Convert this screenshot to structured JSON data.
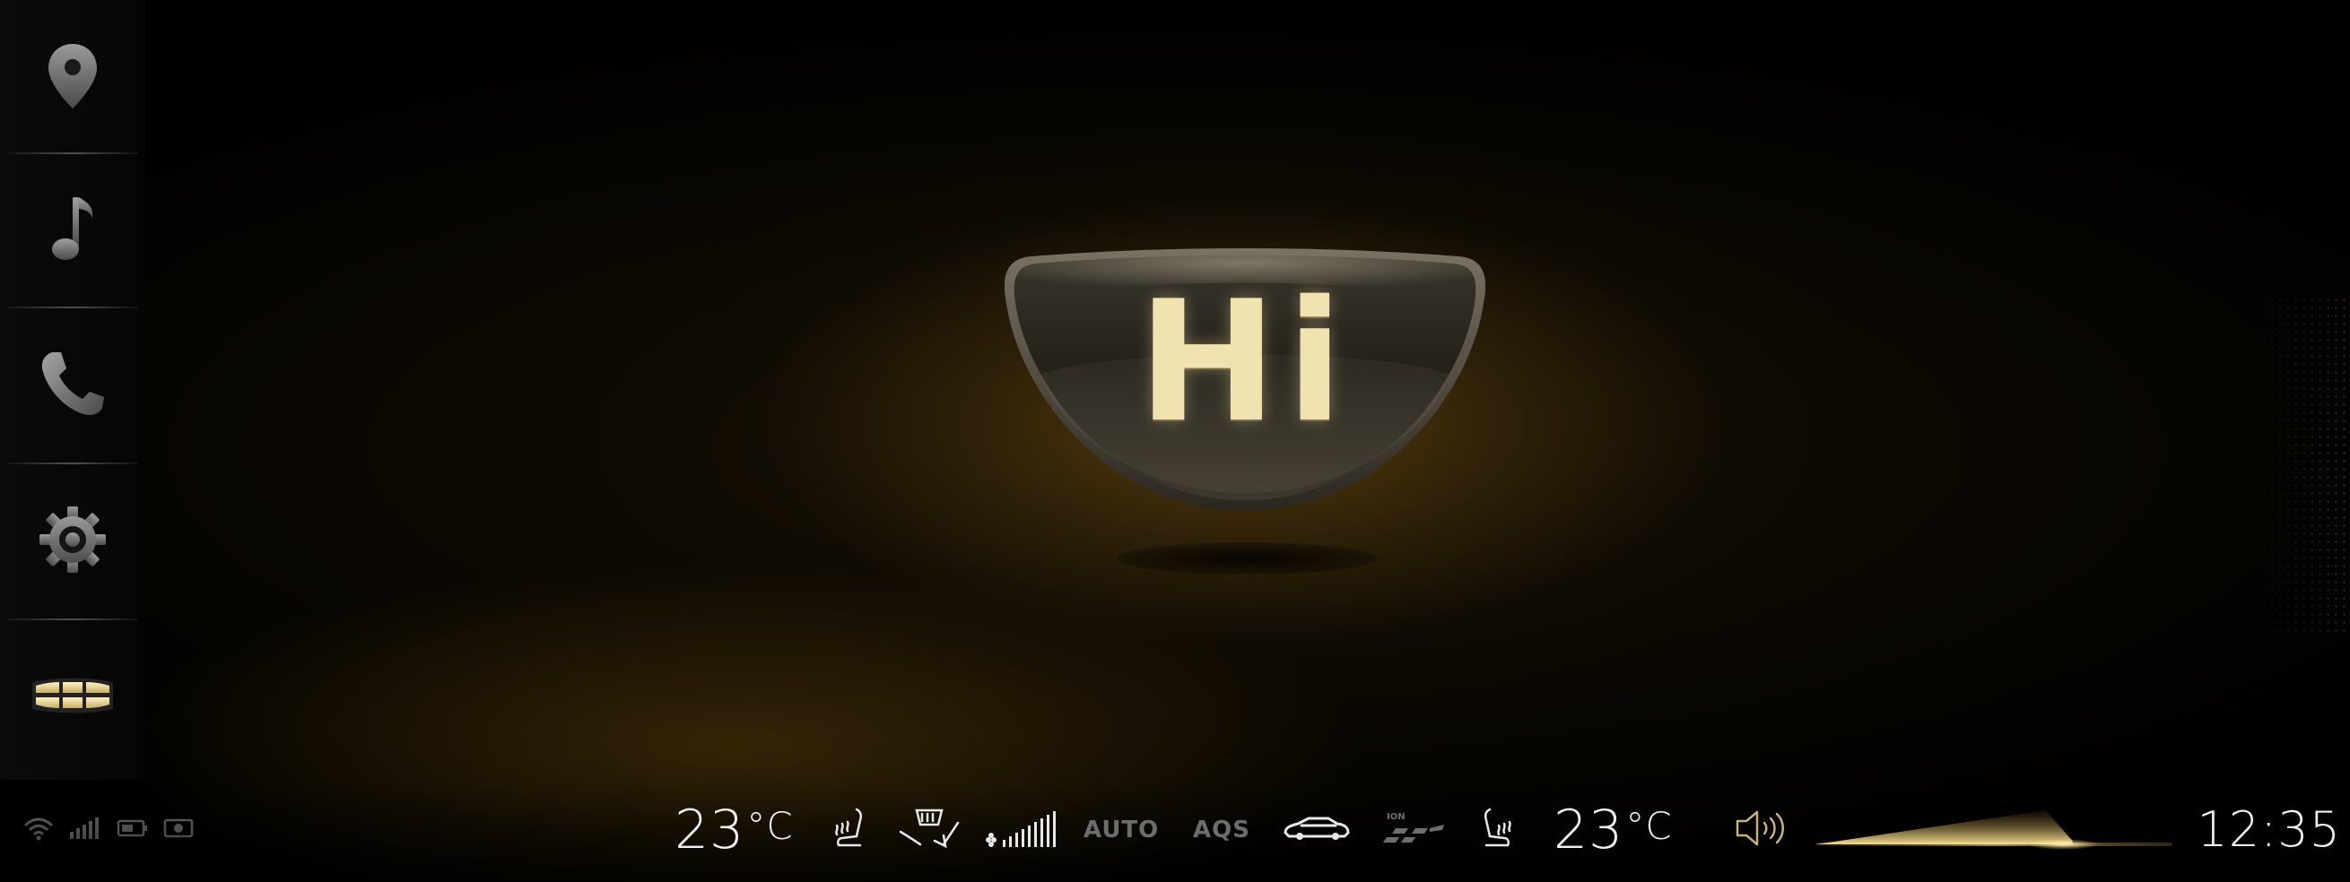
{
  "sidebar": {
    "items": [
      {
        "name": "navigation",
        "icon": "location-pin-icon"
      },
      {
        "name": "music",
        "icon": "music-note-icon"
      },
      {
        "name": "phone",
        "icon": "phone-icon"
      },
      {
        "name": "settings",
        "icon": "gear-icon"
      },
      {
        "name": "home",
        "icon": "brand-logo-icon"
      }
    ]
  },
  "status": {
    "icons": [
      "wifi-icon",
      "signal-icon",
      "battery-icon",
      "camera-icon"
    ]
  },
  "greeting": {
    "text": "Hi"
  },
  "climate": {
    "driver_temp": "23",
    "passenger_temp": "23",
    "temp_unit": "°C",
    "auto_label": "AUTO",
    "aqs_label": "AQS",
    "fan_level": 9,
    "fan_level_max": 9,
    "ion_label": "ION"
  },
  "volume": {
    "icon": "speaker-icon",
    "level": 0.72
  },
  "clock": {
    "time": "12:35"
  },
  "colors": {
    "accent_gold": "#efe3b0",
    "background": "#000000",
    "icon_gray": "#6e6e6e"
  }
}
